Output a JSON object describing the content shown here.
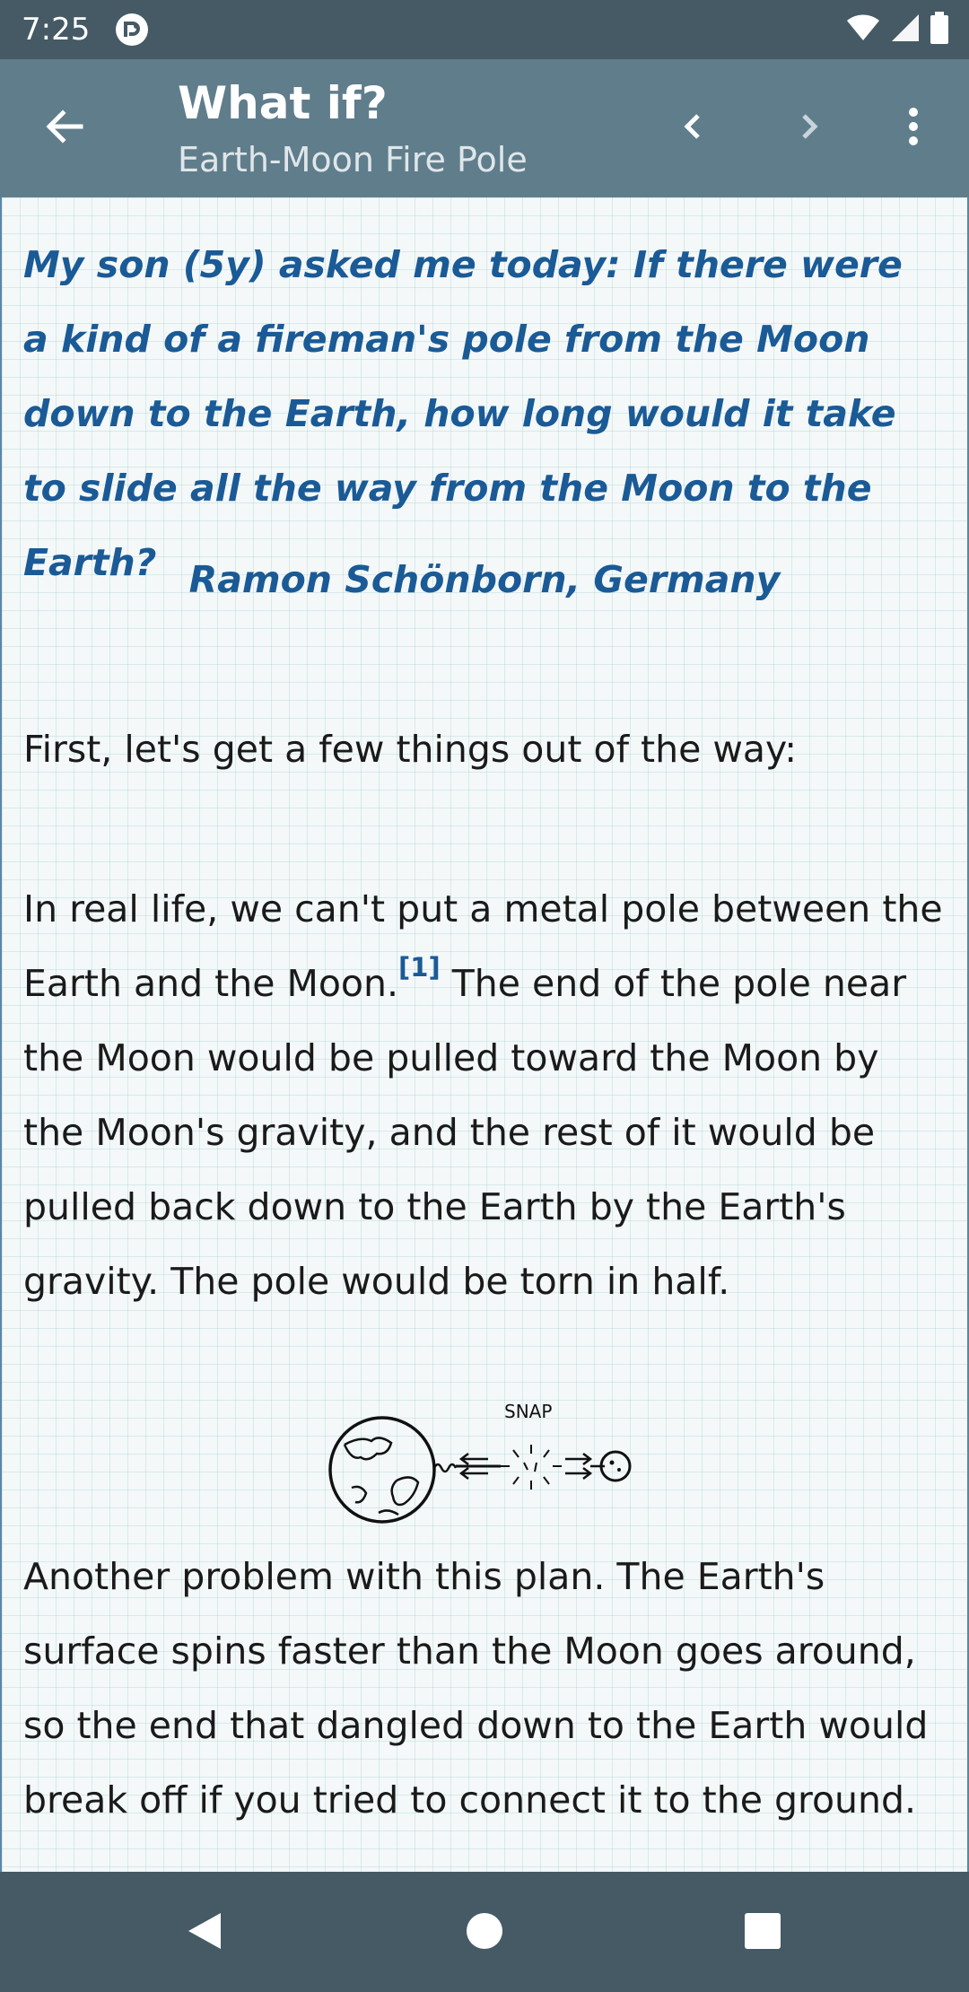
{
  "status_bar": {
    "time": "7:25",
    "icons": [
      "app-notification-icon",
      "wifi-icon",
      "signal-icon",
      "battery-icon"
    ]
  },
  "app_bar": {
    "title": "What if?",
    "subtitle": "Earth-Moon Fire Pole",
    "icons": [
      "back-arrow-icon",
      "chevron-left-icon",
      "chevron-right-icon",
      "more-vert-icon"
    ]
  },
  "article": {
    "question": "My son (5y) asked me today: If there were a kind of a fireman's pole from the Moon down to the Earth, how long would it take to slide all the way from the Moon to the Earth?",
    "asker": "Ramon Schönborn, Germany",
    "para1": "First, let's get a few things out of the way:",
    "para2_before": "In real life, we can't put a metal pole between the Earth and the Moon.",
    "footnote": "[1]",
    "para2_after": " The end of the pole near the Moon would be pulled toward the Moon by the Moon's gravity, and the rest of it would be pulled back down to the Earth by the Earth's gravity. The pole would be torn in half.",
    "illustration_label": "SNAP",
    "para3": "Another problem with this plan. The Earth's surface spins faster than the Moon goes around, so the end that dangled down to the Earth would break off if you tried to connect it to the ground."
  },
  "colors": {
    "status_bar": "#455a64",
    "app_bar": "#607d8b",
    "question_text": "#1a5a96",
    "body_text": "#1a1a1a",
    "nav_bar": "#455a64"
  },
  "nav_bar": {
    "icons": [
      "nav-back-icon",
      "nav-home-icon",
      "nav-recents-icon"
    ]
  }
}
